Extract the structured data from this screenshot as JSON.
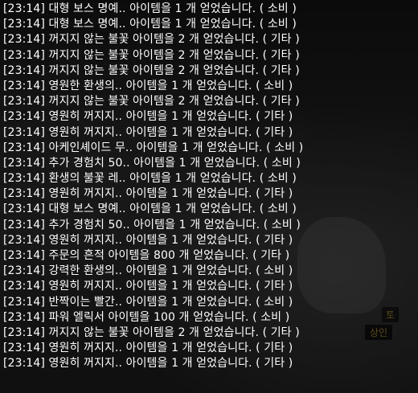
{
  "npc": {
    "label_top": "토",
    "label_bottom": "상인"
  },
  "chat_log": [
    "[23:14] 대형 보스 명예.. 아이템을 1 개 얻었습니다. ( 소비 )",
    "[23:14] 대형 보스 명예.. 아이템을 1 개 얻었습니다. ( 소비 )",
    "[23:14] 꺼지지 않는 불꽃 아이템을 2 개 얻었습니다. ( 기타 )",
    "[23:14] 꺼지지 않는 불꽃 아이템을 2 개 얻었습니다. ( 기타 )",
    "[23:14] 꺼지지 않는 불꽃 아이템을 2 개 얻었습니다. ( 기타 )",
    "[23:14] 영원한 환생의.. 아이템을 1 개 얻었습니다. ( 소비 )",
    "[23:14] 꺼지지 않는 불꽃 아이템을 2 개 얻었습니다. ( 기타 )",
    "[23:14] 영원히 꺼지지.. 아이템을 1 개 얻었습니다. ( 기타 )",
    "[23:14] 영원히 꺼지지.. 아이템을 1 개 얻었습니다. ( 기타 )",
    "[23:14] 아케인셰이드 무.. 아이템을 1 개 얻었습니다. ( 소비 )",
    "[23:14] 추가 경험치 50.. 아이템을 1 개 얻었습니다. ( 소비 )",
    "[23:14] 환생의 불꽃 레.. 아이템을 1 개 얻었습니다. ( 소비 )",
    "[23:14] 영원히 꺼지지.. 아이템을 1 개 얻었습니다. ( 기타 )",
    "[23:14] 대형 보스 명예.. 아이템을 1 개 얻었습니다. ( 소비 )",
    "[23:14] 추가 경험치 50.. 아이템을 1 개 얻었습니다. ( 소비 )",
    "[23:14] 영원히 꺼지지.. 아이템을 1 개 얻었습니다. ( 기타 )",
    "[23:14] 주문의 흔적 아이템을 800 개 얻었습니다. ( 기타 )",
    "[23:14] 강력한 환생의.. 아이템을 1 개 얻었습니다. ( 소비 )",
    "[23:14] 영원히 꺼지지.. 아이템을 1 개 얻었습니다. ( 기타 )",
    "[23:14] 반짝이는 빨간.. 아이템을 1 개 얻었습니다. ( 소비 )",
    "[23:14] 파워 엘릭서 아이템을 100 개 얻었습니다. ( 소비 )",
    "[23:14] 꺼지지 않는 불꽃 아이템을 2 개 얻었습니다. ( 기타 )",
    "[23:14] 영원히 꺼지지.. 아이템을 1 개 얻었습니다. ( 기타 )",
    "[23:14] 영원히 꺼지지.. 아이템을 1 개 얻었습니다. ( 기타 )"
  ]
}
